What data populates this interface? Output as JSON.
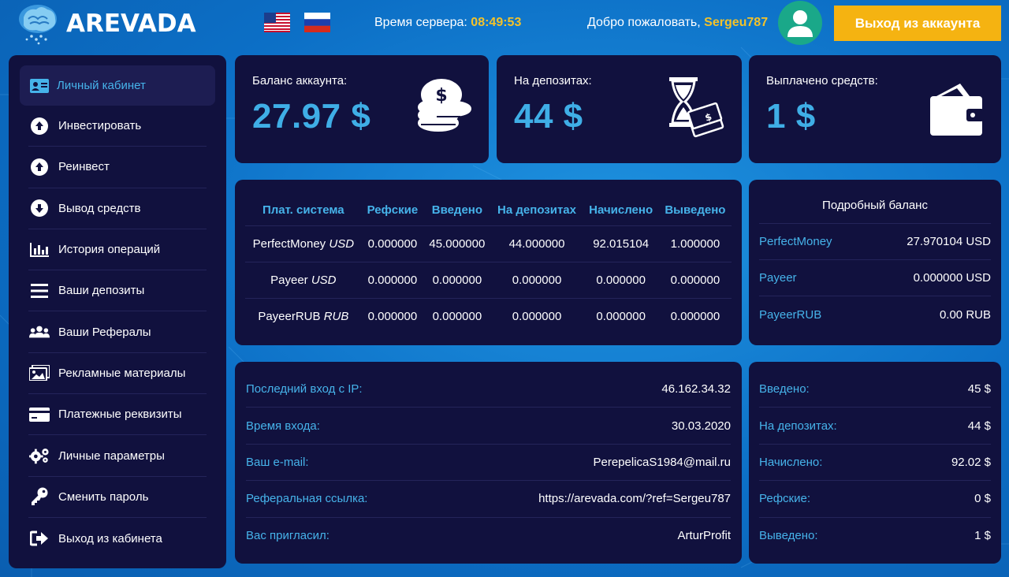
{
  "header": {
    "logo_text": "AREVADA",
    "server_time_label": "Время сервера:",
    "server_time": "08:49:53",
    "welcome_label": "Добро пожаловать,",
    "username": "Sergeu787",
    "logout_label": "Выход из аккаунта"
  },
  "sidebar": {
    "items": [
      {
        "label": "Личный кабинет",
        "icon": "id-card-icon",
        "active": true
      },
      {
        "label": "Инвестировать",
        "icon": "arrow-up-circle-icon"
      },
      {
        "label": "Реинвест",
        "icon": "arrow-up-circle-icon"
      },
      {
        "label": "Вывод средств",
        "icon": "arrow-down-circle-icon"
      },
      {
        "label": "История операций",
        "icon": "bar-chart-icon"
      },
      {
        "label": "Ваши депозиты",
        "icon": "list-icon"
      },
      {
        "label": "Ваши Рефералы",
        "icon": "users-icon"
      },
      {
        "label": "Рекламные материалы",
        "icon": "images-icon"
      },
      {
        "label": "Платежные реквизиты",
        "icon": "credit-card-icon"
      },
      {
        "label": "Личные параметры",
        "icon": "gears-icon"
      },
      {
        "label": "Сменить пароль",
        "icon": "key-icon"
      },
      {
        "label": "Выход из кабинета",
        "icon": "sign-out-icon"
      }
    ]
  },
  "cards": [
    {
      "label": "Баланс аккаунта:",
      "value": "27.97 $",
      "icon": "coins-icon"
    },
    {
      "label": "На депозитах:",
      "value": "44 $",
      "icon": "hourglass-money-icon"
    },
    {
      "label": "Выплачено средств:",
      "value": "1 $",
      "icon": "wallet-icon"
    }
  ],
  "payment_table": {
    "headers": [
      "Плат. система",
      "Рефские",
      "Введено",
      "На депозитах",
      "Начислено",
      "Выведено"
    ],
    "rows": [
      {
        "system": "PerfectMoney",
        "currency": "USD",
        "cells": [
          "0.000000",
          "45.000000",
          "44.000000",
          "92.015104",
          "1.000000"
        ]
      },
      {
        "system": "Payeer",
        "currency": "USD",
        "cells": [
          "0.000000",
          "0.000000",
          "0.000000",
          "0.000000",
          "0.000000"
        ]
      },
      {
        "system": "PayeerRUB",
        "currency": "RUB",
        "cells": [
          "0.000000",
          "0.000000",
          "0.000000",
          "0.000000",
          "0.000000"
        ]
      }
    ]
  },
  "detail_balance": {
    "title": "Подробный баланс",
    "rows": [
      {
        "k": "PerfectMoney",
        "v": "27.970104 USD"
      },
      {
        "k": "Payeer",
        "v": "0.000000 USD"
      },
      {
        "k": "PayeerRUB",
        "v": "0.00 RUB"
      }
    ]
  },
  "account_info": [
    {
      "k": "Последний вход с IP:",
      "v": "46.162.34.32"
    },
    {
      "k": "Время входа:",
      "v": "30.03.2020"
    },
    {
      "k": "Ваш e-mail:",
      "v": "PerepelicaS1984@mail.ru"
    },
    {
      "k": "Реферальная ссылка:",
      "v": "https://arevada.com/?ref=Sergeu787"
    },
    {
      "k": "Вас пригласил:",
      "v": "ArturProfit"
    }
  ],
  "summary": [
    {
      "k": "Введено:",
      "v": "45 $"
    },
    {
      "k": "На депозитах:",
      "v": "44 $"
    },
    {
      "k": "Начислено:",
      "v": "92.02 $"
    },
    {
      "k": "Рефские:",
      "v": "0 $"
    },
    {
      "k": "Выведено:",
      "v": "1 $"
    }
  ],
  "colors": {
    "accent": "#46b3ea",
    "highlight": "#f3c22a",
    "button": "#f5b311",
    "panel": "#11113e"
  }
}
